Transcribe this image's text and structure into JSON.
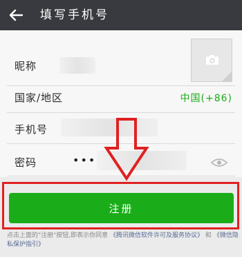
{
  "header": {
    "back_icon": "back-arrow-icon",
    "title": "填写手机号"
  },
  "form": {
    "nickname_label": "昵称",
    "country_label": "国家/地区",
    "country_value": "中国(+86)",
    "phone_label": "手机号",
    "password_label": "密码",
    "password_value": "••••",
    "avatar_icon": "camera-icon",
    "show_password_icon": "eye-icon"
  },
  "register_button": "注册",
  "agreement": {
    "prefix": "点击上面的\"注册\"按钮,即表示你同意",
    "link1": "《腾讯微信软件许可及服务协议》",
    "middle": "和",
    "link2": "《微信隐私保护指引》"
  },
  "colors": {
    "accent_green": "#1aad19",
    "header_bg": "#393a3f",
    "annotation_red": "#e02020"
  }
}
